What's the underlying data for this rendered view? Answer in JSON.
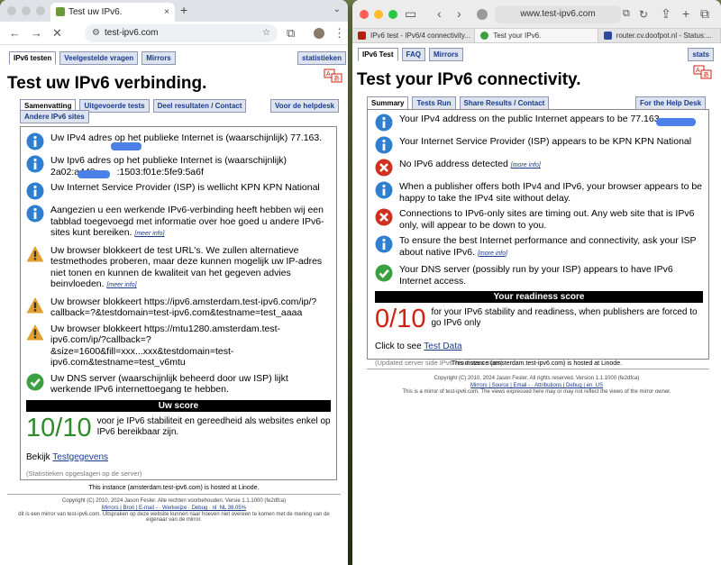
{
  "left": {
    "tab_title": "Test uw IPv6.",
    "url": "test-ipv6.com",
    "tabs": [
      "IPv6 testen",
      "Veelgestelde vragen",
      "Mirrors"
    ],
    "stats_tab": "statistieken",
    "heading": "Test uw IPv6 verbinding.",
    "subtabs": [
      "Samenvatting",
      "Uitgevoerde tests",
      "Deel resultaten / Contact"
    ],
    "help_tab": "Voor de helpdesk",
    "other_tab": "Andere IPv6 sites",
    "messages": [
      {
        "icon": "info",
        "text": "Uw IPv4 adres op het publieke Internet is (waarschijnlijk) 77.163.",
        "more": ""
      },
      {
        "icon": "info",
        "text": "Uw Ipv6 adres op het publieke Internet is (waarschijnlijk) 2a02:a449:          :1503:f01e:5fe9:5a6f",
        "more": ""
      },
      {
        "icon": "info",
        "text": "Uw Internet Service Provider (ISP) is wellicht KPN KPN National",
        "more": ""
      },
      {
        "icon": "info",
        "text": "Aangezien u een werkende IPv6-verbinding heeft hebben wij een tabblad toegevoegd met informatie over hoe goed u andere IPv6-sites kunt bereiken.",
        "more": "[meer info]"
      },
      {
        "icon": "warn",
        "text": "Uw browser blokkeert de test URL's. We zullen alternatieve testmethodes proberen, maar deze kunnen mogelijk uw IP-adres niet tonen en kunnen de kwaliteit van het gegeven advies beinvloeden.",
        "more": "[meer info]"
      },
      {
        "icon": "warn",
        "text": "Uw browser blokkeert https://ipv6.amsterdam.test-ipv6.com/ip/?callback=?&testdomain=test-ipv6.com&testname=test_aaaa",
        "more": ""
      },
      {
        "icon": "warn",
        "text": "Uw browser blokkeert https://mtu1280.amsterdam.test-ipv6.com/ip/?callback=?&size=1600&fill=xxx...xxx&testdomain=test-ipv6.com&testname=test_v6mtu",
        "more": ""
      },
      {
        "icon": "ok",
        "text": "Uw DNS server (waarschijnlijk beheerd door uw ISP) lijkt werkende IPv6 internettoegang te hebben.",
        "more": ""
      }
    ],
    "score_label": "Uw score",
    "score": "10/10",
    "score_text": "voor je IPv6 stabiliteit en gereedheid als websites enkel op IPv6 bereikbaar zijn.",
    "data_prefix": "Bekijk",
    "data_link": "Testgegevens",
    "stats_note": "(Statistieken opgeslagen op de server)",
    "instance": "This instance (amsterdam.test-ipv6.com) is hosted at Linode.",
    "copyright": "Copyright (C) 2010, 2024 Jason Fesler. Alle rechten voorbehouden. Versie 1.1.1000 (fe2dfca)",
    "footer_links": "Mirrors | Bron | E-mail - · Werkwijze · Debug · nl_NL 38.05%",
    "mirror_note": "dit is een mirror van test-ipv6.com. Uitspraken op deze website kunnen naar hoeven niet overeen te komen met de mening van de eigenaar van de mirror."
  },
  "right": {
    "url": "www.test-ipv6.com",
    "browser_tabs": [
      "IPv6 test - IPv6/4 connectivity...",
      "Test your IPv6.",
      "router.cv.doofpot.nl - Status:..."
    ],
    "tabs": [
      "IPv6 Test",
      "FAQ",
      "Mirrors"
    ],
    "stats_tab": "stats",
    "heading": "Test your IPv6 connectivity.",
    "subtabs": [
      "Summary",
      "Tests Run",
      "Share Results / Contact"
    ],
    "help_tab": "For the Help Desk",
    "messages": [
      {
        "icon": "info",
        "text": "Your IPv4 address on the public Internet appears to be 77.163.",
        "more": ""
      },
      {
        "icon": "info",
        "text": "Your Internet Service Provider (ISP) appears to be KPN KPN National",
        "more": ""
      },
      {
        "icon": "err",
        "text": "No IPv6 address detected",
        "more": "[more info]"
      },
      {
        "icon": "info",
        "text": "When a publisher offers both IPv4 and IPv6, your browser appears to be happy to take the IPv4 site without delay.",
        "more": ""
      },
      {
        "icon": "err",
        "text": "Connections to IPv6-only sites are timing out. Any web site that is IPv6 only, will appear to be down to you.",
        "more": ""
      },
      {
        "icon": "info",
        "text": "To ensure the best Internet performance and connectivity, ask your ISP about native IPv6.",
        "more": "[more info]"
      },
      {
        "icon": "ok",
        "text": "Your DNS server (possibly run by your ISP) appears to have IPv6 Internet access.",
        "more": ""
      }
    ],
    "score_label": "Your readiness score",
    "score": "0/10",
    "score_text": "for your IPv6 stability and readiness, when publishers are forced to go IPv6 only",
    "data_prefix": "Click to see",
    "data_link": "Test Data",
    "stats_note": "(Updated server side IPv6 readiness stats)",
    "instance": "This instance (amsterdam.test-ipv6.com) is hosted at Linode.",
    "copyright": "Copyright (C) 2010, 2024 Jason Fesler. All rights reserved. Version 1.1.1000 (fe2dfca)",
    "footer_links": "Mirrors | Source | Email - · Attributions | Debug | en_US",
    "mirror_note": "This is a mirror of test-ipv6.com. The views expressed here may or may not reflect the views of the mirror owner."
  },
  "colors": {
    "info": "#2f7fd0",
    "warn": "#e0a030",
    "err": "#d03020",
    "ok": "#3aa040",
    "score_good": "#2f8a2a",
    "score_bad": "#d02010"
  }
}
